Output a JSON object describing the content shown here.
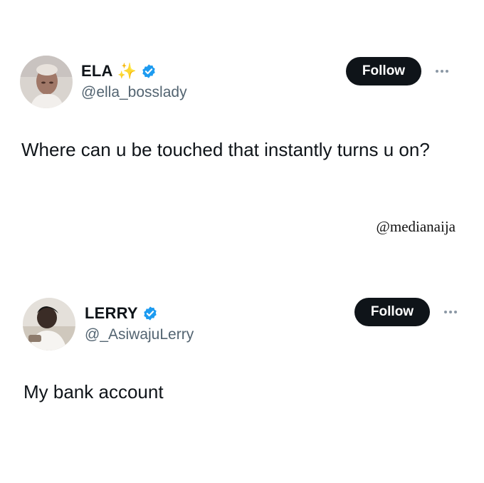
{
  "posts": [
    {
      "display_name": "ELA",
      "emoji": "✨",
      "verified_icon": "verified-badge-icon",
      "handle": "@ella_bosslady",
      "follow_label": "Follow",
      "text": "Where can u be touched that instantly turns u on?"
    },
    {
      "display_name": "LERRY",
      "verified_icon": "verified-badge-icon",
      "handle": "@_AsiwajuLerry",
      "follow_label": "Follow",
      "text": "My bank account"
    }
  ],
  "watermark": "@medianaija",
  "colors": {
    "text": "#0f1419",
    "secondary": "#536471",
    "verified": "#1d9bf0",
    "button_bg": "#0f1419",
    "button_text": "#ffffff"
  }
}
